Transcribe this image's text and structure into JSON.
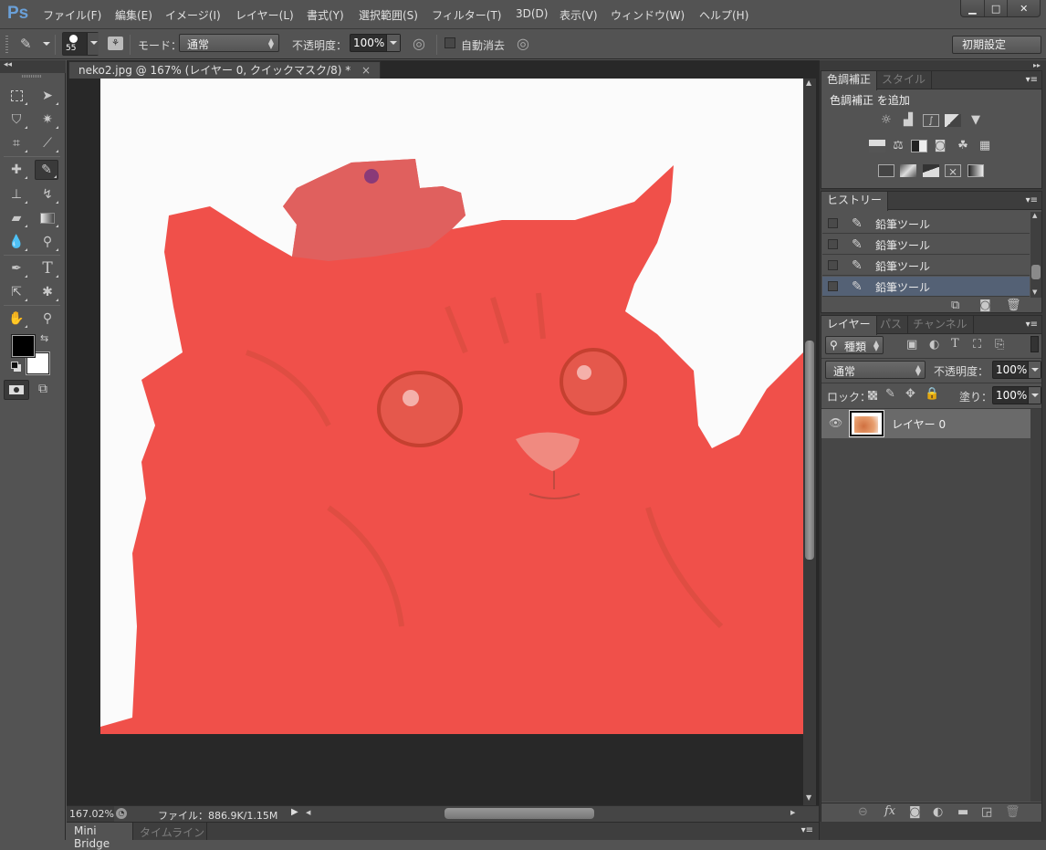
{
  "app": {
    "logo": "Ps"
  },
  "menu": [
    {
      "label": "ファイル(F)"
    },
    {
      "label": "編集(E)"
    },
    {
      "label": "イメージ(I)"
    },
    {
      "label": "レイヤー(L)"
    },
    {
      "label": "書式(Y)"
    },
    {
      "label": "選択範囲(S)"
    },
    {
      "label": "フィルター(T)"
    },
    {
      "label": "3D(D)"
    },
    {
      "label": "表示(V)"
    },
    {
      "label": "ウィンドウ(W)"
    },
    {
      "label": "ヘルプ(H)"
    }
  ],
  "window_controls": {
    "minimize": "▁",
    "maximize": "□",
    "close": "✕"
  },
  "options_bar": {
    "brush_size": "55",
    "mode_label": "モード：",
    "mode_value": "通常",
    "opacity_label": "不透明度：",
    "opacity_value": "100%",
    "auto_erase_label": "自動消去",
    "auto_erase_checked": false,
    "workspace_button": "初期設定"
  },
  "toolbox": {
    "active_tool": "pencil",
    "foreground_color": "#000000",
    "background_color": "#ffffff",
    "tools": [
      "rectangular-marquee",
      "move",
      "polygonal-lasso",
      "magic-wand",
      "crop",
      "eyedropper",
      "spot-healing",
      "pencil",
      "clone-stamp",
      "history-brush",
      "eraser",
      "gradient",
      "blur",
      "dodge",
      "pen",
      "type",
      "path-selection",
      "custom-shape",
      "hand",
      "zoom"
    ]
  },
  "document": {
    "tab_title": "neko2.jpg @ 167% (レイヤー 0, クイックマスク/8) *",
    "close_glyph": "×",
    "zoom": "167.02%",
    "file_info": "ファイル：886.9K/1.15M",
    "quick_mask_color": "#f0504a"
  },
  "bottom_tabs": [
    {
      "label": "Mini Bridge",
      "active": true
    },
    {
      "label": "タイムライン",
      "active": false
    }
  ],
  "adjustments_panel": {
    "tabs": [
      {
        "label": "色調補正",
        "active": true
      },
      {
        "label": "スタイル",
        "active": false
      }
    ],
    "heading": "色調補正 を追加",
    "icons_row1": [
      "brightness-contrast",
      "levels",
      "curves",
      "exposure",
      "vibrance"
    ],
    "icons_row2": [
      "hue-saturation",
      "color-balance",
      "black-white",
      "photo-filter",
      "channel-mixer",
      "color-lookup"
    ],
    "icons_row3": [
      "invert",
      "posterize",
      "threshold",
      "selective-color",
      "gradient-map"
    ]
  },
  "history_panel": {
    "tabs": [
      {
        "label": "ヒストリー",
        "active": true
      }
    ],
    "items": [
      {
        "label": "鉛筆ツール",
        "selected": false
      },
      {
        "label": "鉛筆ツール",
        "selected": false
      },
      {
        "label": "鉛筆ツール",
        "selected": false
      },
      {
        "label": "鉛筆ツール",
        "selected": true
      }
    ]
  },
  "layers_panel": {
    "tabs": [
      {
        "label": "レイヤー",
        "active": true
      },
      {
        "label": "パス",
        "active": false
      },
      {
        "label": "チャンネル",
        "active": false
      }
    ],
    "filter_label": "種類",
    "blend_mode": "通常",
    "opacity_label": "不透明度：",
    "opacity_value": "100%",
    "lock_label": "ロック：",
    "fill_label": "塗り：",
    "fill_value": "100%",
    "layers": [
      {
        "name": "レイヤー 0",
        "visible": true
      }
    ]
  }
}
